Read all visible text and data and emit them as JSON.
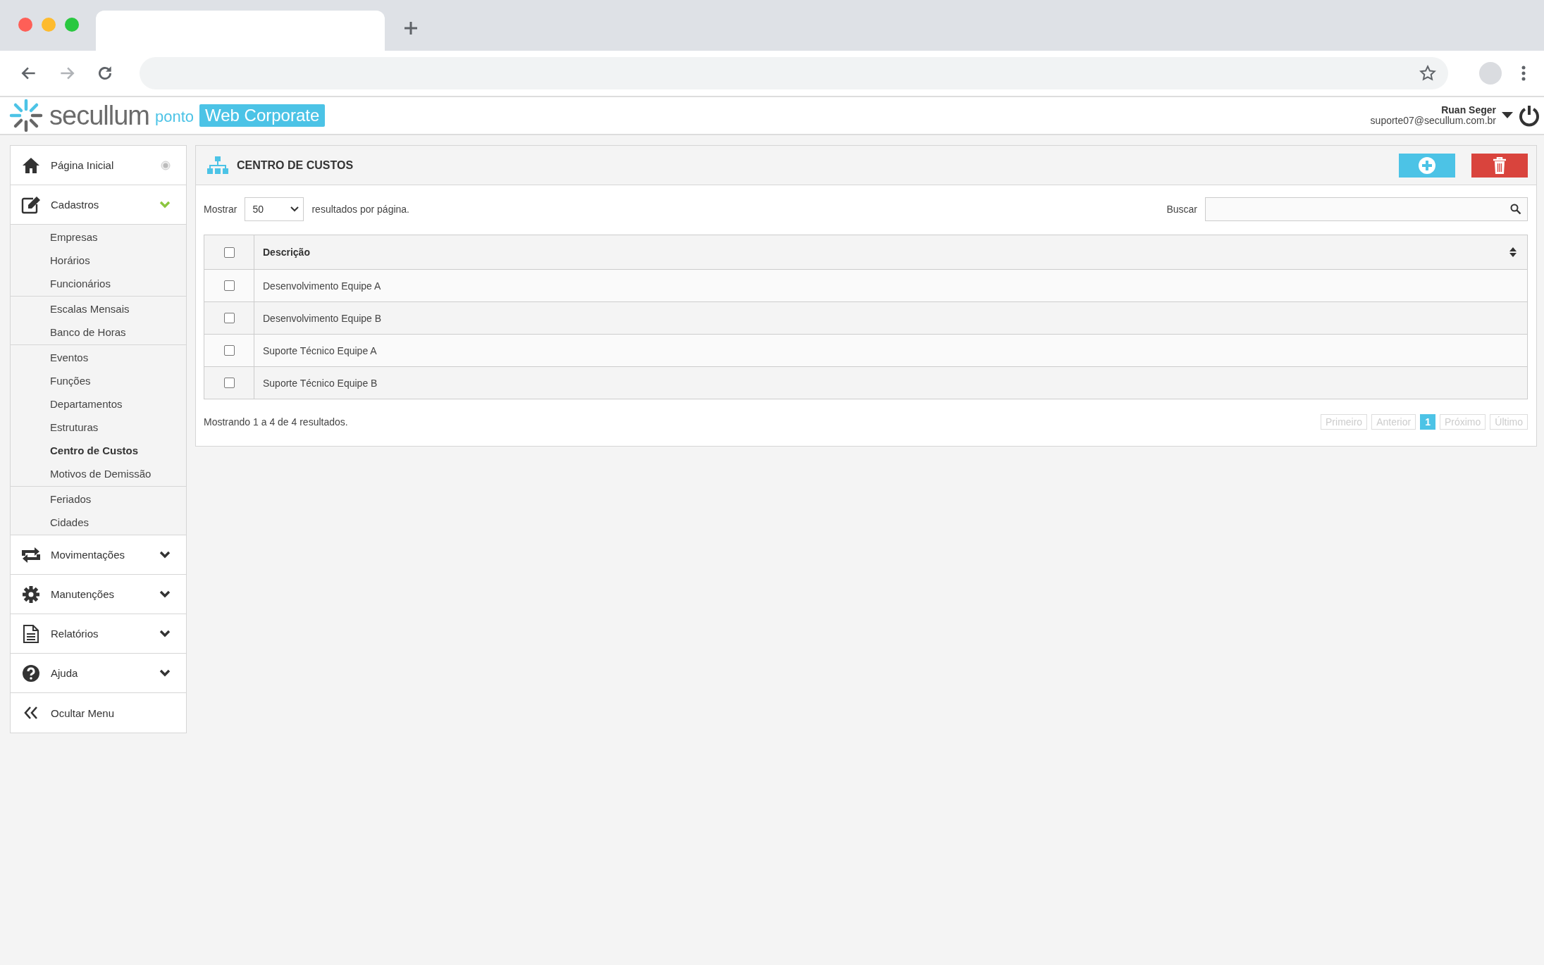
{
  "header": {
    "brand": "secullum",
    "product": "ponto",
    "edition": "Web Corporate",
    "user": {
      "name": "Ruan Seger",
      "email": "suporte07@secullum.com.br"
    }
  },
  "sidebar": {
    "items": [
      {
        "label": "Página Inicial",
        "kind": "link"
      },
      {
        "label": "Cadastros",
        "kind": "menu",
        "expanded": true,
        "groups": [
          {
            "items": [
              {
                "label": "Empresas",
                "selected": false
              },
              {
                "label": "Horários",
                "selected": false
              },
              {
                "label": "Funcionários",
                "selected": false
              }
            ]
          },
          {
            "items": [
              {
                "label": "Escalas Mensais",
                "selected": false
              },
              {
                "label": "Banco de Horas",
                "selected": false
              }
            ]
          },
          {
            "items": [
              {
                "label": "Eventos",
                "selected": false
              },
              {
                "label": "Funções",
                "selected": false
              },
              {
                "label": "Departamentos",
                "selected": false
              },
              {
                "label": "Estruturas",
                "selected": false
              },
              {
                "label": "Centro de Custos",
                "selected": true
              },
              {
                "label": "Motivos de Demissão",
                "selected": false
              }
            ]
          },
          {
            "items": [
              {
                "label": "Feriados",
                "selected": false
              },
              {
                "label": "Cidades",
                "selected": false
              }
            ]
          }
        ]
      },
      {
        "label": "Movimentações",
        "kind": "menu",
        "expanded": false
      },
      {
        "label": "Manutenções",
        "kind": "menu",
        "expanded": false
      },
      {
        "label": "Relatórios",
        "kind": "menu",
        "expanded": false
      },
      {
        "label": "Ajuda",
        "kind": "menu",
        "expanded": false
      },
      {
        "label": "Ocultar Menu",
        "kind": "link"
      }
    ]
  },
  "page": {
    "title": "CENTRO DE CUSTOS",
    "show_label": "Mostrar",
    "page_size": "50",
    "per_page_label": "resultados por página.",
    "search_label": "Buscar",
    "table": {
      "select_all_checked": false,
      "columns": [
        "Descrição"
      ],
      "rows": [
        {
          "description": "Desenvolvimento Equipe A",
          "checked": false
        },
        {
          "description": "Desenvolvimento Equipe B",
          "checked": false
        },
        {
          "description": "Suporte Técnico Equipe A",
          "checked": false
        },
        {
          "description": "Suporte Técnico Equipe B",
          "checked": false
        }
      ]
    },
    "info": "Mostrando 1 a 4 de 4 resultados.",
    "pagination": [
      {
        "label": "Primeiro",
        "selected": false,
        "disabled": true
      },
      {
        "label": "Anterior",
        "selected": false,
        "disabled": true
      },
      {
        "label": "1",
        "selected": true,
        "disabled": false
      },
      {
        "label": "Próximo",
        "selected": false,
        "disabled": true
      },
      {
        "label": "Último",
        "selected": false,
        "disabled": true
      }
    ]
  }
}
